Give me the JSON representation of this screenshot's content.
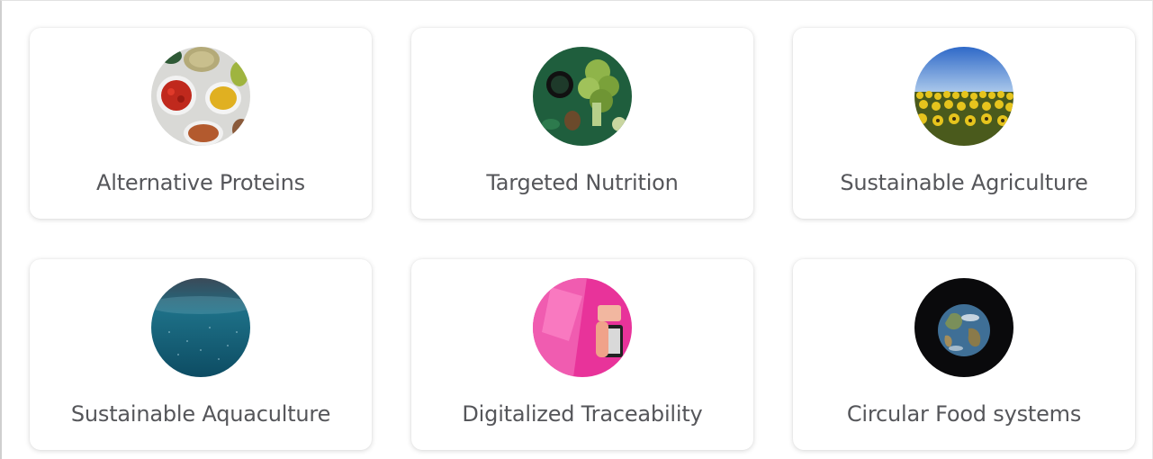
{
  "categories": [
    {
      "label": "Alternative Proteins",
      "icon": "spices-bowls-image"
    },
    {
      "label": "Targeted Nutrition",
      "icon": "greens-broccoli-image"
    },
    {
      "label": "Sustainable Agriculture",
      "icon": "sunflower-field-image"
    },
    {
      "label": "Sustainable Aquaculture",
      "icon": "underwater-ocean-image"
    },
    {
      "label": "Digitalized Traceability",
      "icon": "pink-phone-scan-image"
    },
    {
      "label": "Circular Food systems",
      "icon": "earth-globe-image"
    }
  ],
  "colors": {
    "card_background": "#ffffff",
    "label_text": "#55565a"
  }
}
